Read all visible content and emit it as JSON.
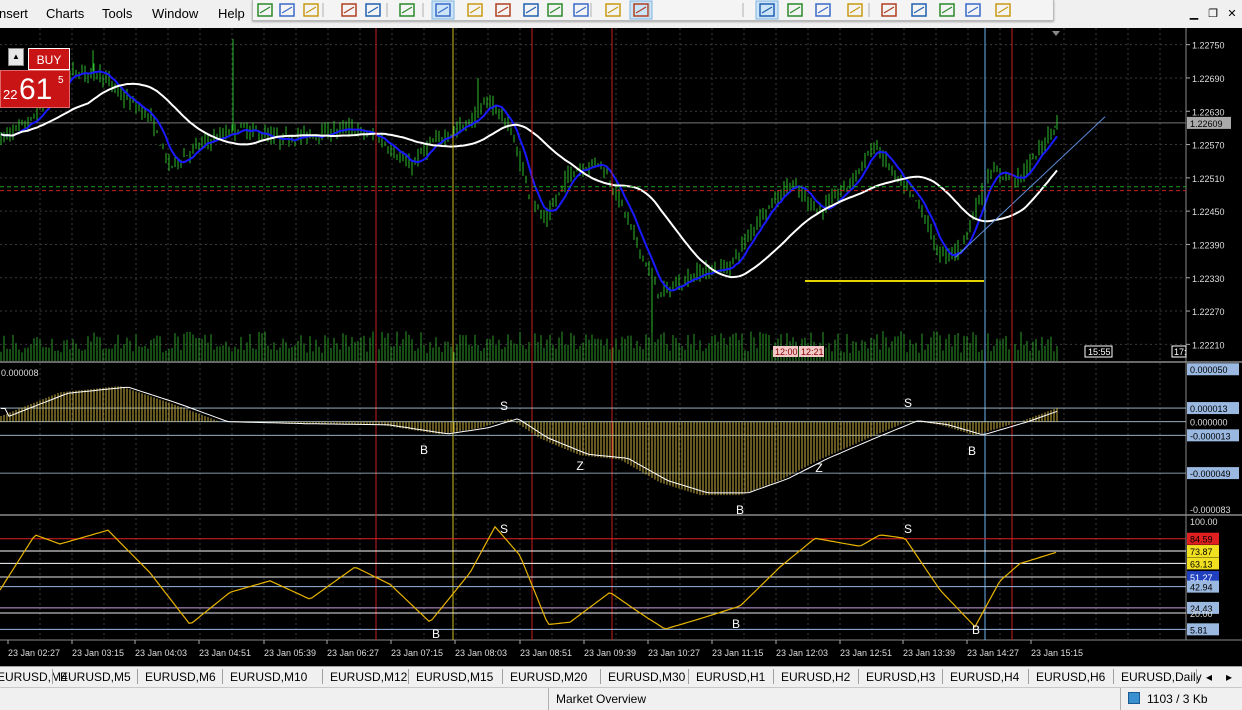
{
  "menu": {
    "items": [
      "nsert",
      "Charts",
      "Tools",
      "Window",
      "Help"
    ]
  },
  "toolbar": {
    "icons": [
      "new-chart-icon",
      "profiles-icon",
      "templates-icon",
      "market-watch-icon",
      "navigator-icon",
      "new-order-icon",
      "bar-chart-icon",
      "candlestick-icon",
      "line-chart-icon",
      "zoom-in-icon",
      "zoom-out-icon",
      "tile-windows-icon",
      "auto-scroll-icon",
      "chart-shift-icon",
      "cursor-icon",
      "crosshair-icon",
      "vertical-line-icon",
      "horizontal-line-icon",
      "trendline-icon",
      "fibonacci-icon",
      "text-icon",
      "text-label-icon",
      "arrows-icon"
    ]
  },
  "trade_panel": {
    "buy_label": "BUY",
    "price_prefix": "22",
    "price_main": "61",
    "price_sup": "5"
  },
  "main_chart": {
    "price_axis": [
      "1.22750",
      "1.22690",
      "1.22630",
      "1.22570",
      "1.22510",
      "1.22450",
      "1.22390",
      "1.22330",
      "1.22270",
      "1.22210"
    ],
    "current_price": "1.22609",
    "ylim": [
      1.2218,
      1.2278
    ],
    "time_markers": [
      "12:00",
      "12:21"
    ],
    "time_box": "15:55",
    "time_box_right": "17:"
  },
  "macd_panel": {
    "title_value": "0.000008",
    "axis_labels": [
      "0.000050",
      "0.000013",
      "0.000000",
      "-0.000013",
      "-0.000049",
      "-0.000083"
    ],
    "signals": [
      {
        "label": "B",
        "idx": 0
      },
      {
        "label": "S",
        "idx": 1
      },
      {
        "label": "Z",
        "idx": 2
      },
      {
        "label": "B",
        "idx": 3
      },
      {
        "label": "Z",
        "idx": 4
      },
      {
        "label": "S",
        "idx": 5
      },
      {
        "label": "B",
        "idx": 6
      }
    ]
  },
  "stoch_panel": {
    "axis_labels": [
      "100.00",
      "84.59",
      "73.87",
      "63.13",
      "51.27",
      "42.94",
      "24.43",
      "20.00",
      "5.81"
    ],
    "signals": [
      {
        "label": "S",
        "idx": 0
      },
      {
        "label": "B",
        "idx": 1
      },
      {
        "label": "B",
        "idx": 2
      },
      {
        "label": "S",
        "idx": 3
      },
      {
        "label": "B",
        "idx": 4
      }
    ]
  },
  "time_axis": [
    "23 Jan 02:27",
    "23 Jan 03:15",
    "23 Jan 04:03",
    "23 Jan 04:51",
    "23 Jan 05:39",
    "23 Jan 06:27",
    "23 Jan 07:15",
    "23 Jan 08:03",
    "23 Jan 08:51",
    "23 Jan 09:39",
    "23 Jan 10:27",
    "23 Jan 11:15",
    "23 Jan 12:03",
    "23 Jan 12:51",
    "23 Jan 13:39",
    "23 Jan 14:27",
    "23 Jan 15:15"
  ],
  "tabs": [
    "EURUSD,M4",
    "EURUSD,M5",
    "EURUSD,M6",
    "EURUSD,M10",
    "EURUSD,M12",
    "EURUSD,M15",
    "EURUSD,M20",
    "EURUSD,M30",
    "EURUSD,H1",
    "EURUSD,H2",
    "EURUSD,H3",
    "EURUSD,H4",
    "EURUSD,H6",
    "EURUSD,Daily"
  ],
  "status": {
    "market_overview": "Market Overview",
    "traffic": "1103 / 3 Kb"
  },
  "colors": {
    "bg": "#000000",
    "grid": "#3a3a3a",
    "candles": "#2dbd2d",
    "ma_blue": "#1a1aff",
    "ma_white": "#ffffff",
    "volume": "#2a9a2a",
    "red_line": "#cc2020",
    "yellow_line": "#e6d400",
    "cyan_line": "#6ab4f0",
    "stoch_line": "#e8b400",
    "macd_hist": "#c8b040"
  }
}
